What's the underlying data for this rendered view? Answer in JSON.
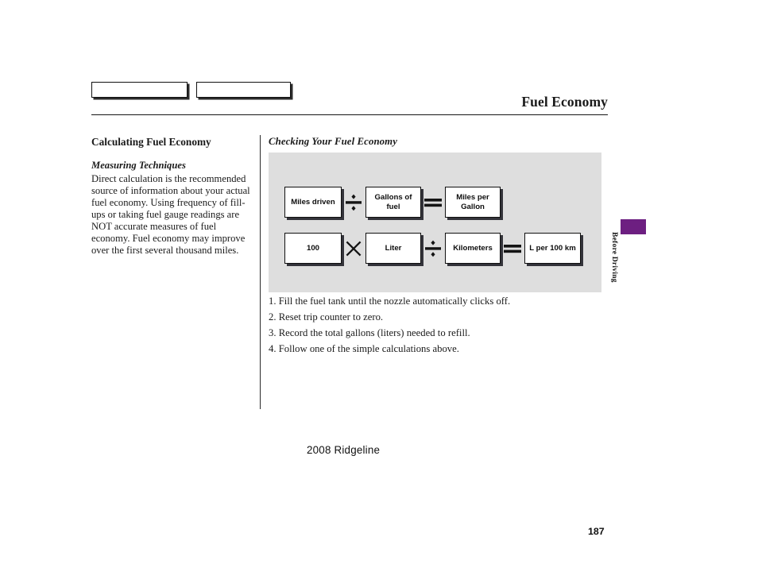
{
  "header": {
    "title": "Fuel Economy",
    "tab_boxes": [
      "",
      ""
    ]
  },
  "left_column": {
    "section_heading": "Calculating Fuel Economy",
    "sub_heading": "Measuring Techniques",
    "body": "Direct calculation is the recommended source of information about your actual fuel economy. Using frequency of fill-ups or taking fuel gauge readings are NOT accurate measures of fuel economy. Fuel economy may improve over the first several thousand miles."
  },
  "right_column": {
    "heading": "Checking Your Fuel Economy",
    "figure": {
      "rows": [
        {
          "terms": [
            "Miles driven",
            "Gallons of fuel",
            "Miles per Gallon"
          ],
          "operators": [
            "divide-icon",
            "equals-icon"
          ]
        },
        {
          "terms": [
            "100",
            "Liter",
            "Kilometers",
            "L per 100 km"
          ],
          "operators": [
            "multiply-icon",
            "divide-icon",
            "equals-icon"
          ]
        }
      ],
      "panel_color": "#dedede"
    },
    "steps": [
      "1. Fill the fuel tank until the nozzle automatically clicks off.",
      "2. Reset trip counter to zero.",
      "3. Record the total gallons (liters) needed to refill.",
      "4. Follow one of the simple calculations above."
    ]
  },
  "side_tab": {
    "label": "Before Driving",
    "color": "#6d1f81"
  },
  "footer": {
    "page_number": "187",
    "model": "2008  Ridgeline"
  }
}
